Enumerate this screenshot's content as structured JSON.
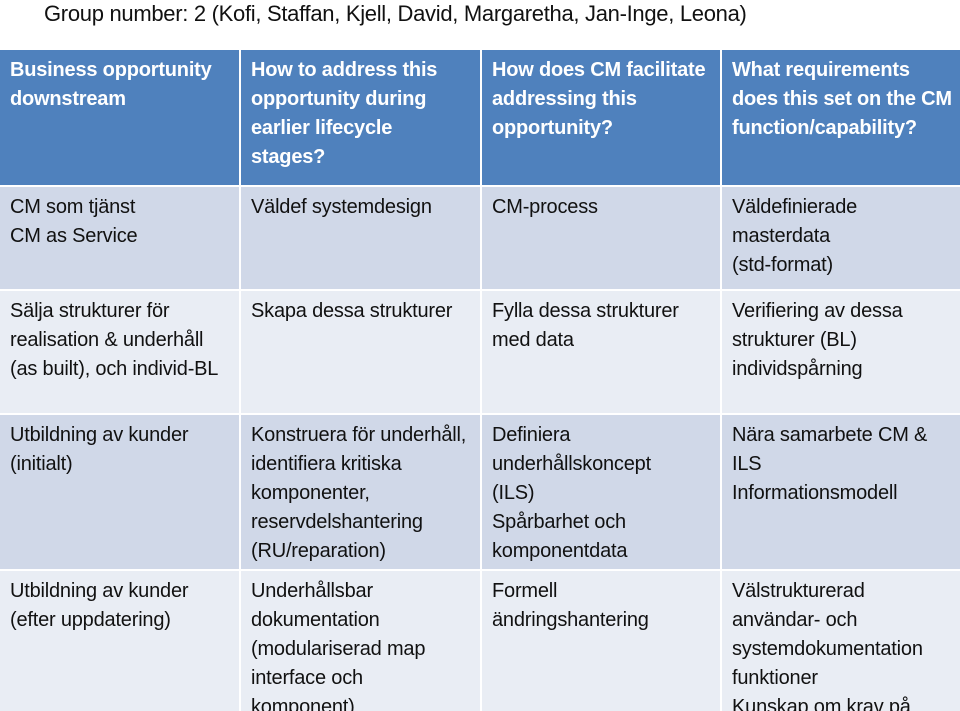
{
  "title": "Group number: 2 (Kofi, Staffan, Kjell, David, Margaretha, Jan-Inge, Leona)",
  "colors": {
    "header": "#4F81BD",
    "band_dark": "#D0D8E8",
    "band_light": "#E9EDF4"
  },
  "table": {
    "headers": [
      "Business opportunity downstream",
      "How to address this opportunity during earlier lifecycle stages?",
      "How does CM facilitate addressing this opportunity?",
      "What requirements does this set on the CM function/capability?"
    ],
    "rows": [
      [
        "CM som tjänst\nCM as Service",
        "Väldef systemdesign",
        "CM-process",
        "Väldefinierade masterdata\n(std-format)"
      ],
      [
        "Sälja strukturer för realisation & underhåll (as built), och individ-BL",
        "Skapa dessa strukturer",
        "Fylla dessa strukturer med data",
        "Verifiering av dessa strukturer (BL)\nindividspårning"
      ],
      [
        "Utbildning av kunder (initialt)",
        "Konstruera för underhåll, identifiera kritiska komponenter, reservdelshantering (RU/reparation)",
        "Definiera underhållskoncept\n(ILS)\nSpårbarhet och komponentdata",
        "Nära samarbete CM & ILS\nInformationsmodell"
      ],
      [
        "Utbildning av kunder (efter uppdatering)",
        "Underhållsbar dokumentation (modulariserad  map interface och komponent)",
        "Formell ändringshantering",
        "Välstrukturerad användar- och systemdokumentation funktioner\nKunskap om krav på"
      ]
    ]
  }
}
